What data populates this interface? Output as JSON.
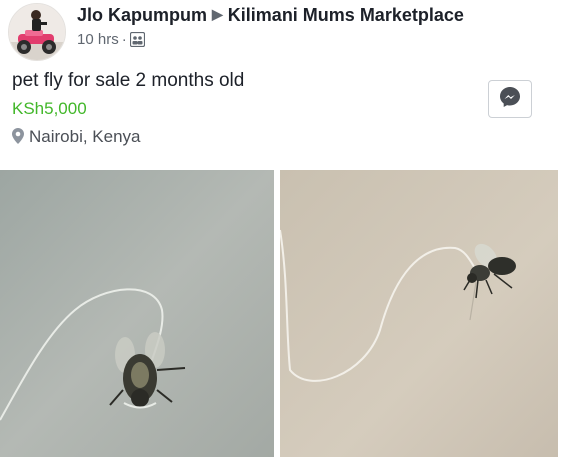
{
  "post": {
    "author": "Jlo Kapumpum",
    "group": "Kilimani Mums Marketplace",
    "time": "10 hrs",
    "separator": "·",
    "audience_icon": "group-icon",
    "avatar_icon": "avatar-icon"
  },
  "listing": {
    "title": "pet fly for sale 2 months old",
    "price": "KSh5,000",
    "location": "Nairobi, Kenya",
    "location_icon": "location-pin-icon"
  },
  "actions": {
    "message_icon": "messenger-icon"
  },
  "colors": {
    "price": "#42b72a",
    "text": "#1d2129",
    "secondary": "#606770"
  },
  "photos": [
    {
      "name": "fly-photo-1",
      "subject": "fly-on-string-image"
    },
    {
      "name": "fly-photo-2",
      "subject": "fly-on-string-image"
    }
  ]
}
